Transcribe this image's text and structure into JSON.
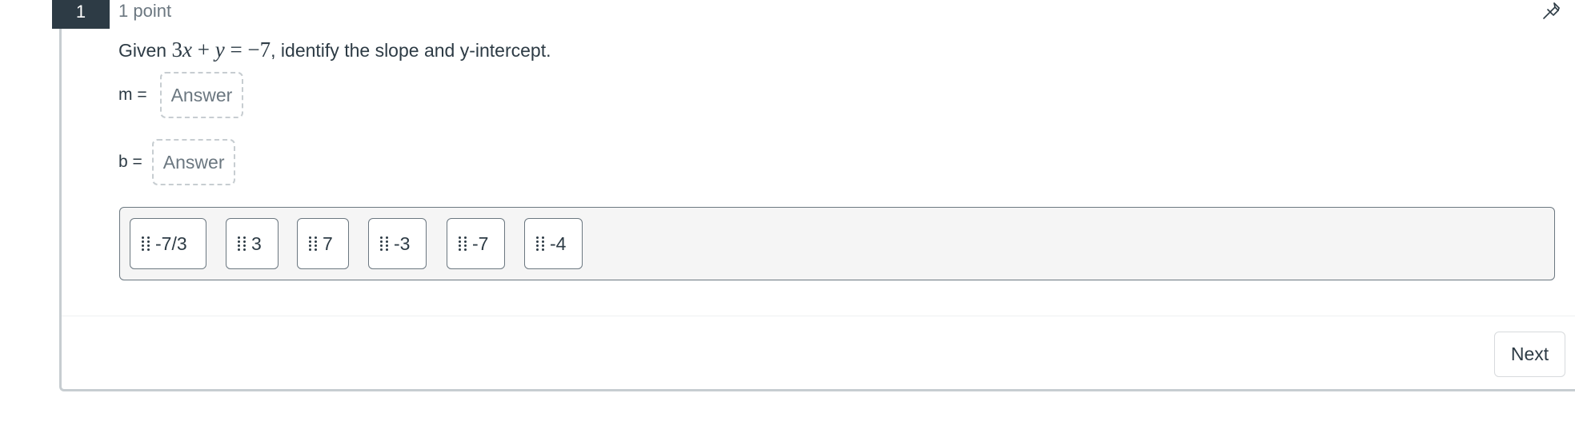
{
  "question": {
    "number": "1",
    "points": "1 point",
    "prefix": "Given",
    "equation": {
      "coef": "3",
      "var_x": "x",
      "plus": "+",
      "var_y": "y",
      "equals": "=",
      "rhs": "−7"
    },
    "suffix": ", identify the slope and y-intercept."
  },
  "icons": {
    "pin": "pushpin-icon",
    "grip": "drag-handle-icon"
  },
  "blanks": [
    {
      "label": "m =",
      "placeholder": "Answer"
    },
    {
      "label": "b =",
      "placeholder": "Answer"
    }
  ],
  "answer_bank": [
    {
      "value": "-7/3"
    },
    {
      "value": "3"
    },
    {
      "value": "7"
    },
    {
      "value": "-3"
    },
    {
      "value": "-7"
    },
    {
      "value": "-4"
    }
  ],
  "footer": {
    "next_label": "Next"
  }
}
